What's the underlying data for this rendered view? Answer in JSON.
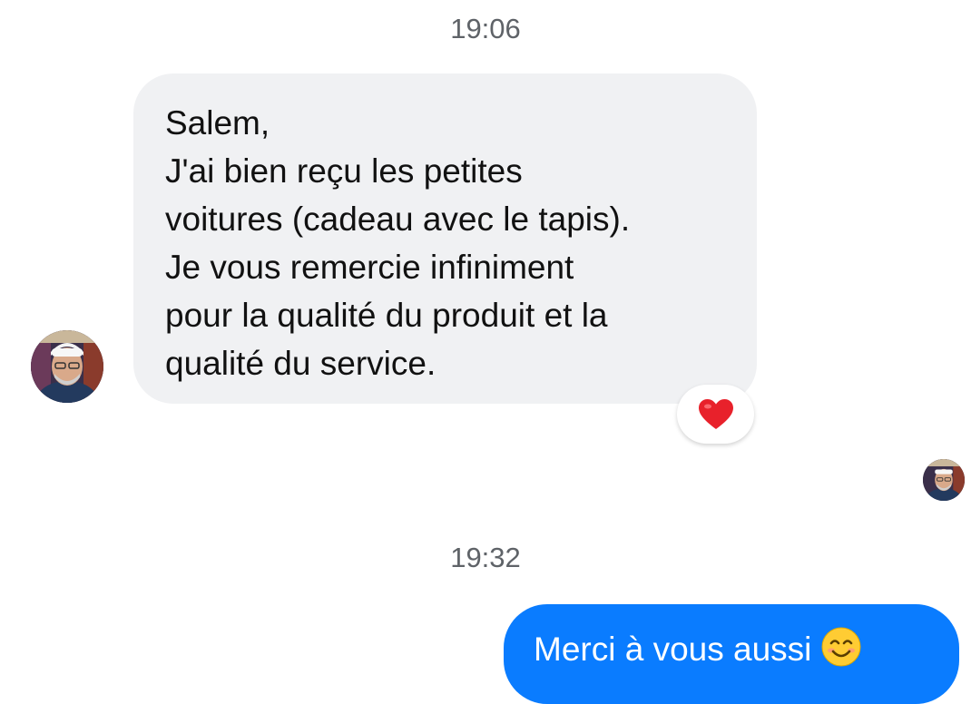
{
  "conversation": {
    "timestamps": [
      "19:06",
      "19:32"
    ],
    "incoming_message": {
      "lines": [
        "Salem,",
        "J'ai bien reçu les petites",
        "voitures (cadeau avec le tapis).",
        "Je vous remercie infiniment",
        "pour la qualité du produit et la",
        "qualité du service."
      ],
      "reaction": "heart-reaction"
    },
    "outgoing_message": {
      "text": "Merci à vous aussi",
      "emoji": "smiling-face-emoji"
    }
  },
  "colors": {
    "incoming_bubble": "#f0f1f3",
    "outgoing_bubble": "#0a7cff",
    "timestamp_text": "#5f6368",
    "reaction_heart": "#e8212b"
  }
}
